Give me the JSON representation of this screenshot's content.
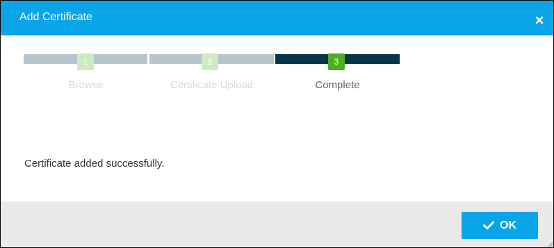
{
  "dialog": {
    "title": "Add Certificate",
    "close_icon": "close-icon"
  },
  "stepper": {
    "steps": [
      {
        "number": "1",
        "label": "Browse",
        "state": "done"
      },
      {
        "number": "2",
        "label": "Certificate Upload",
        "state": "done"
      },
      {
        "number": "3",
        "label": "Complete",
        "state": "current"
      }
    ]
  },
  "body": {
    "message": "Certificate added successfully."
  },
  "footer": {
    "ok_label": "OK",
    "ok_icon": "check-icon"
  },
  "colors": {
    "accent": "#0aa5e9",
    "done_track": "#b8c4cb",
    "active_track": "#06354a",
    "pending_badge": "#cdebc0",
    "current_badge": "#4eae22"
  }
}
